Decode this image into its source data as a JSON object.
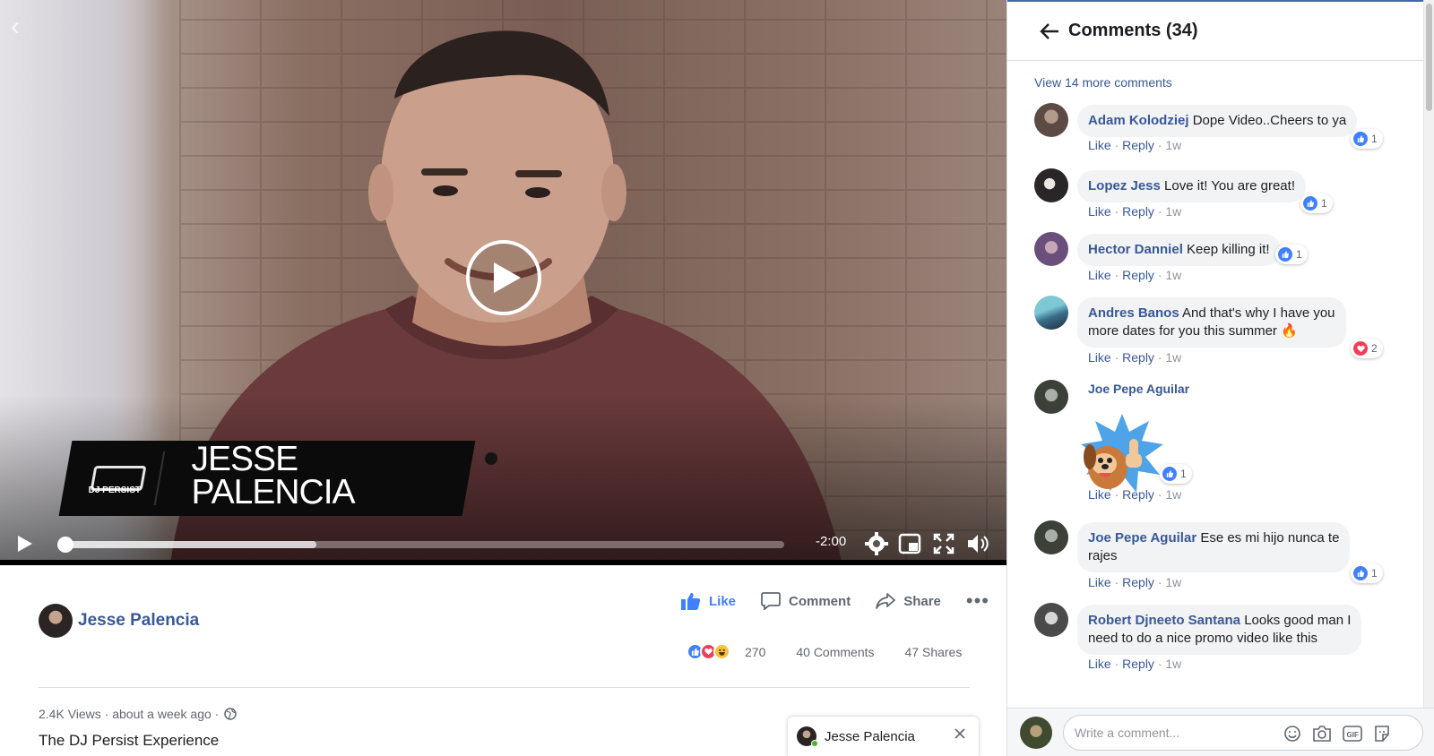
{
  "video": {
    "overlay_name": "JESSE\nPALENCIA",
    "overlay_logo": "DJ PERSIST",
    "time_remaining": "-2:00",
    "progress": 0.0,
    "buffered": 0.35
  },
  "post": {
    "author": "Jesse Palencia",
    "actions": {
      "like": "Like",
      "comment": "Comment",
      "share": "Share",
      "more": "•••"
    },
    "reactions_count": "270",
    "comments_count": "40 Comments",
    "shares_count": "47 Shares",
    "views": "2.4K Views",
    "time": "about a week ago",
    "title": "The DJ Persist Experience"
  },
  "chat_tab": {
    "name": "Jesse Palencia"
  },
  "comments_panel": {
    "title": "Comments (34)",
    "view_more": "View 14 more comments",
    "like_label": "Like",
    "reply_label": "Reply",
    "comments": [
      {
        "name": "Adam Kolodziej",
        "text": "Dope Video..Cheers to ya",
        "age": "1w",
        "reaction": "like",
        "reaction_count": "1"
      },
      {
        "name": "Lopez Jess",
        "text": "Love it! You are great!",
        "age": "1w",
        "reaction": "like",
        "reaction_count": "1"
      },
      {
        "name": "Hector Danniel",
        "text": "Keep killing it!",
        "age": "1w",
        "reaction": "like",
        "reaction_count": "1"
      },
      {
        "name": "Andres Banos",
        "text": "And that's why I have you",
        "text2": "more dates for you this summer 🔥",
        "age": "1w",
        "reaction": "love",
        "reaction_count": "2"
      },
      {
        "name": "Joe Pepe Aguilar",
        "text": "",
        "sticker": "thumbs-up-dog-sticker",
        "age": "1w",
        "reaction": "like",
        "reaction_count": "1"
      },
      {
        "name": "Joe Pepe Aguilar",
        "text": "Ese es mi hijo nunca te",
        "text2": "rajes",
        "age": "1w",
        "reaction": "like",
        "reaction_count": "1"
      },
      {
        "name": "Robert Djneeto Santana",
        "text": "Looks good man I",
        "text2": "need to do a nice promo video like this",
        "age": "1w"
      }
    ],
    "composer_placeholder": "Write a comment..."
  },
  "colors": {
    "brand": "#4267b2",
    "link": "#385898",
    "like_blue": "#4080ff",
    "love_red": "#f33e58"
  }
}
